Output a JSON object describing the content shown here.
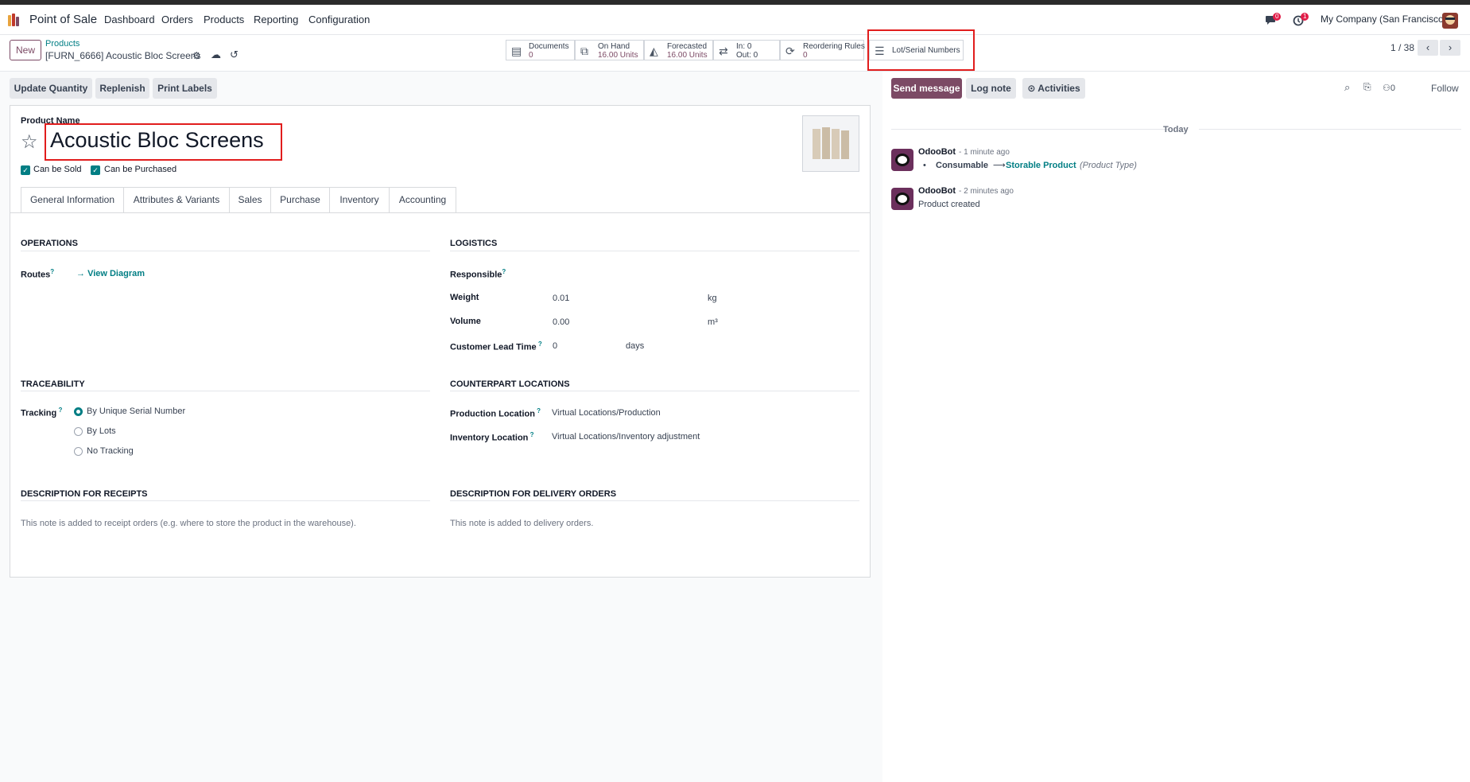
{
  "navbar": {
    "app_name": "Point of Sale",
    "menu": [
      "Dashboard",
      "Orders",
      "Products",
      "Reporting",
      "Configuration"
    ],
    "messages_count": "0",
    "activities_count": "1",
    "company": "My Company (San Francisco)"
  },
  "control_panel": {
    "new_label": "New",
    "breadcrumb_parent": "Products",
    "breadcrumb_current": "[FURN_6666] Acoustic Bloc Screens",
    "smart_buttons": {
      "documents": {
        "label": "Documents",
        "value": "0"
      },
      "on_hand": {
        "label": "On Hand",
        "value": "16.00 Units"
      },
      "forecasted": {
        "label": "Forecasted",
        "value": "16.00 Units"
      },
      "in_out": {
        "label": "In: 0",
        "value": "Out: 0"
      },
      "reordering": {
        "label": "Reordering Rules",
        "value": "0"
      },
      "lots": {
        "label": "Lot/Serial Numbers"
      }
    },
    "pager": "1 / 38"
  },
  "actions": {
    "update_quantity": "Update Quantity",
    "replenish": "Replenish",
    "print_labels": "Print Labels"
  },
  "form": {
    "product_name_label": "Product Name",
    "product_name": "Acoustic Bloc Screens",
    "can_be_sold": "Can be Sold",
    "can_be_purchased": "Can be Purchased",
    "tabs": [
      "General Information",
      "Attributes & Variants",
      "Sales",
      "Purchase",
      "Inventory",
      "Accounting"
    ],
    "active_tab": "Inventory",
    "operations": {
      "title": "OPERATIONS",
      "routes_label": "Routes",
      "view_diagram": "View Diagram"
    },
    "logistics": {
      "title": "LOGISTICS",
      "responsible_label": "Responsible",
      "weight_label": "Weight",
      "weight_value": "0.01",
      "weight_unit": "kg",
      "volume_label": "Volume",
      "volume_value": "0.00",
      "volume_unit": "m³",
      "lead_time_label": "Customer Lead Time",
      "lead_time_value": "0",
      "lead_time_unit": "days"
    },
    "traceability": {
      "title": "TRACEABILITY",
      "tracking_label": "Tracking",
      "options": [
        "By Unique Serial Number",
        "By Lots",
        "No Tracking"
      ],
      "selected": "By Unique Serial Number"
    },
    "counterpart": {
      "title": "COUNTERPART LOCATIONS",
      "production_label": "Production Location",
      "production_value": "Virtual Locations/Production",
      "inventory_label": "Inventory Location",
      "inventory_value": "Virtual Locations/Inventory adjustment"
    },
    "desc_receipts": {
      "title": "DESCRIPTION FOR RECEIPTS",
      "placeholder": "This note is added to receipt orders (e.g. where to store the product in the warehouse)."
    },
    "desc_delivery": {
      "title": "DESCRIPTION FOR DELIVERY ORDERS",
      "placeholder": "This note is added to delivery orders."
    }
  },
  "chatter": {
    "send_message": "Send message",
    "log_note": "Log note",
    "activities": "Activities",
    "followers_count": "0",
    "follow": "Follow",
    "date_separator": "Today",
    "messages": [
      {
        "author": "OdooBot",
        "time": "- 1 minute ago",
        "old": "Consumable",
        "new": "Storable Product",
        "field": "(Product Type)"
      },
      {
        "author": "OdooBot",
        "time": "- 2 minutes ago",
        "body": "Product created"
      }
    ]
  },
  "colors": {
    "brand": "#7c4a65",
    "accent": "#017e84",
    "highlight": "#e11d1d"
  }
}
